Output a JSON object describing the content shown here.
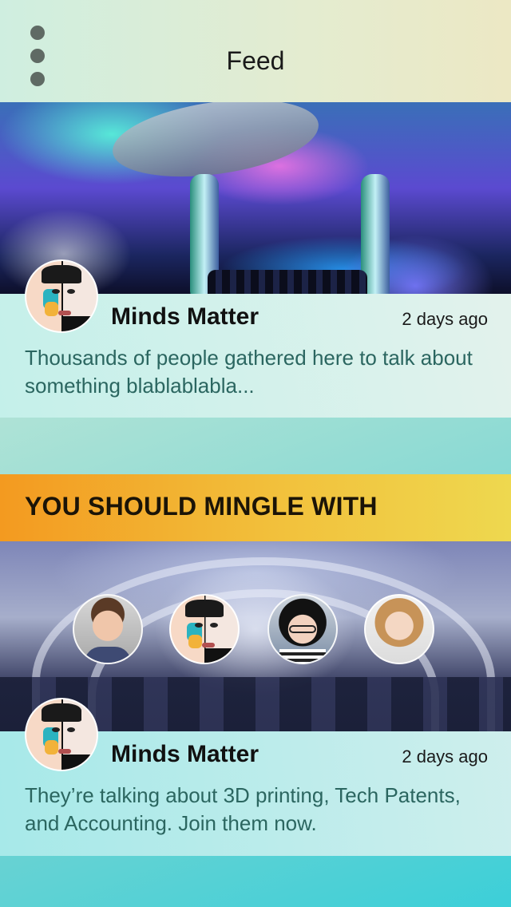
{
  "header": {
    "title": "Feed",
    "menu_icon": "vertical-dots-icon"
  },
  "posts": [
    {
      "author": "Minds Matter",
      "time": "2 days ago",
      "text": "Thousands of people gathered here to talk about something blablablabla..."
    },
    {
      "author": "Minds Matter",
      "time": "2 days ago",
      "text": "They’re talking about 3D printing, Tech Patents, and Accounting. Join them now."
    }
  ],
  "mingle": {
    "title": "YOU SHOULD MINGLE WITH"
  },
  "colors": {
    "banner_start": "#f39a20",
    "banner_end": "#eed84f",
    "post_text": "#2b6660",
    "menu_dots": "#5f6a64"
  }
}
